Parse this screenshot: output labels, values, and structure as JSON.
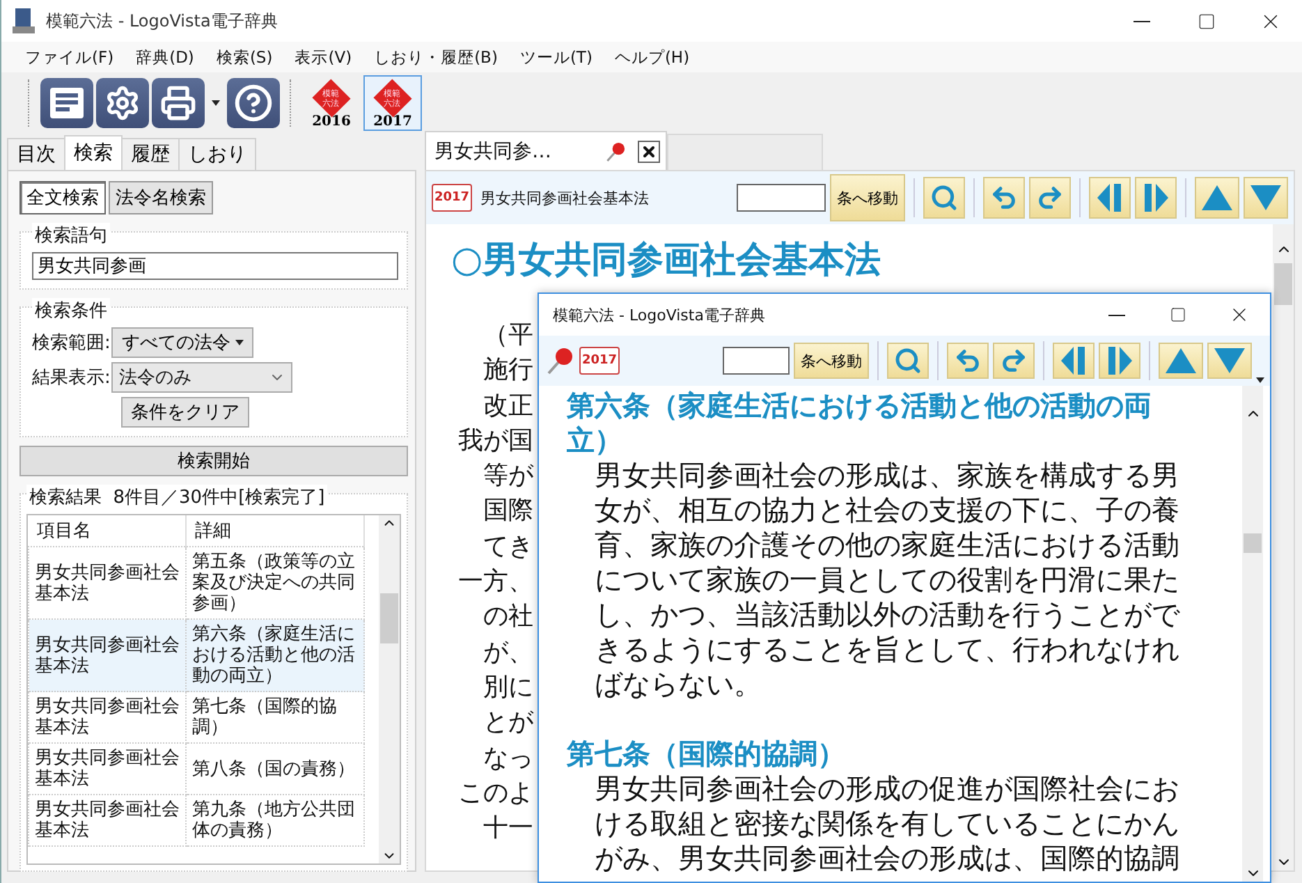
{
  "window": {
    "title": "模範六法 - LogoVista電子辞典"
  },
  "menu": [
    "ファイル(F)",
    "辞典(D)",
    "検索(S)",
    "表示(V)",
    "しおり・履歴(B)",
    "ツール(T)",
    "ヘルプ(H)"
  ],
  "editions": [
    {
      "logo": "模範六法",
      "year": "2016",
      "selected": false
    },
    {
      "logo": "模範六法",
      "year": "2017",
      "selected": true
    }
  ],
  "side_tabs": [
    {
      "label": "目次",
      "selected": false
    },
    {
      "label": "検索",
      "selected": true
    },
    {
      "label": "履歴",
      "selected": false
    },
    {
      "label": "しおり",
      "selected": false
    }
  ],
  "search_modes": [
    {
      "label": "全文検索",
      "selected": true
    },
    {
      "label": "法令名検索",
      "selected": false
    }
  ],
  "query": {
    "legend": "検索語句",
    "value": "男女共同参画"
  },
  "conditions": {
    "legend": "検索条件",
    "range_label": "検索範囲:",
    "range_value": "すべての法令",
    "display_label": "結果表示:",
    "display_value": "法令のみ",
    "clear_button": "条件をクリア"
  },
  "start_button": "検索開始",
  "results": {
    "legend": "検索結果  8件目／30件中[検索完了]",
    "columns": [
      "項目名",
      "詳細"
    ],
    "rows": [
      {
        "name": "男女共同参画社会基本法",
        "detail": "第五条（政策等の立案及び決定への共同参画）",
        "selected": false
      },
      {
        "name": "男女共同参画社会基本法",
        "detail": "第六条（家庭生活における活動と他の活動の両立）",
        "selected": true
      },
      {
        "name": "男女共同参画社会基本法",
        "detail": "第七条（国際的協調）",
        "selected": false
      },
      {
        "name": "男女共同参画社会基本法",
        "detail": "第八条（国の責務）",
        "selected": false
      },
      {
        "name": "男女共同参画社会基本法",
        "detail": "第九条（地方公共団体の責務）",
        "selected": false
      }
    ]
  },
  "doc_tab": {
    "title": "男女共同参…"
  },
  "doc_toolbar": {
    "badge": "2017",
    "title": "男女共同参画社会基本法",
    "jump_button": "条へ移動"
  },
  "document": {
    "heading": "○男女共同参画社会基本法",
    "lines": [
      {
        "text": "（平",
        "kind": "indented"
      },
      {
        "text": "施行",
        "kind": "indented"
      },
      {
        "text": "改正",
        "kind": "indented"
      },
      {
        "text": "我が国",
        "kind": "flush"
      },
      {
        "text": "等が",
        "kind": "indented"
      },
      {
        "text": "国際",
        "kind": "indented"
      },
      {
        "text": "てき",
        "kind": "indented"
      },
      {
        "text": "一方、",
        "kind": "flush"
      },
      {
        "text": "の社",
        "kind": "indented"
      },
      {
        "text": "が、",
        "kind": "indented"
      },
      {
        "text": "別に",
        "kind": "indented"
      },
      {
        "text": "とが",
        "kind": "indented"
      },
      {
        "text": "なっ",
        "kind": "indented"
      },
      {
        "text": "このよ",
        "kind": "flush"
      },
      {
        "text": "十一",
        "kind": "indented"
      }
    ]
  },
  "popup": {
    "title": "模範六法 - LogoVista電子辞典",
    "badge": "2017",
    "jump_button": "条へ移動",
    "articles": [
      {
        "heading": "第六条（家庭生活における活動と他の活動の両立）",
        "body": "男女共同参画社会の形成は、家族を構成する男女が、相互の協力と社会の支援の下に、子の養育、家族の介護その他の家庭生活における活動について家族の一員としての役割を円滑に果たし、かつ、当該活動以外の活動を行うことができるようにすることを旨として、行われなければならない。"
      },
      {
        "heading": "第七条（国際的協調）",
        "body": "男女共同参画社会の形成の促進が国際社会における取組と密接な関係を有していることにかんがみ、男女共同参画社会の形成は、国際的協調"
      }
    ]
  }
}
